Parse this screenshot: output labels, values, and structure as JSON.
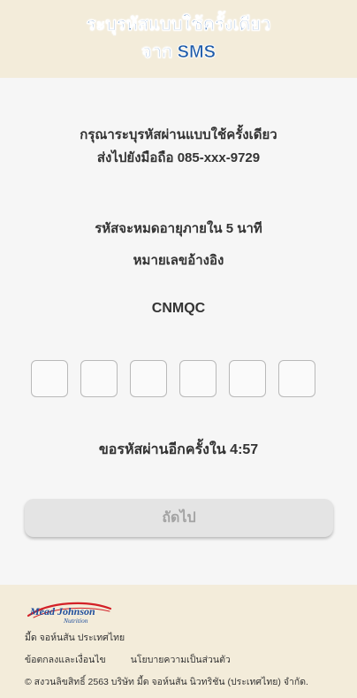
{
  "header": {
    "title_line1": "ระบุรหัสแบบใช้ครั้งเดียว",
    "title_line2": "จาก SMS"
  },
  "main": {
    "instruction_line1": "กรุณาระบุรหัสผ่านแบบใช้ครั้งเดียว",
    "instruction_line2": "ส่งไปยังมือถือ 085-xxx-9729",
    "expiry_text": "รหัสจะหมดอายุภายใน 5 นาที",
    "reference_label": "หมายเลขอ้างอิง",
    "reference_code": "CNMQC",
    "otp_values": [
      "",
      "",
      "",
      "",
      "",
      ""
    ],
    "resend_text": "ขอรหัสผ่านอีกครั้งใน 4:57",
    "next_button_label": "ถัดไป"
  },
  "footer": {
    "logo_text_top": "Mead Johnson",
    "logo_text_bottom": "Nutrition",
    "company_name": "มี้ด จอห์นสัน ประเทศไทย",
    "terms_link": "ข้อตกลงและเงื่อนไข",
    "privacy_link": "นโยบายความเป็นส่วนตัว",
    "copyright": "© สงวนลิขสิทธิ์ 2563 บริษัท มี้ด จอห์นสัน นิวทริชัน (ประเทศไทย) จำกัด."
  },
  "colors": {
    "header_bg": "#f3ecda",
    "title_blue": "#1d5aa8",
    "button_bg": "#e4e4e4",
    "logo_red": "#d32027"
  }
}
